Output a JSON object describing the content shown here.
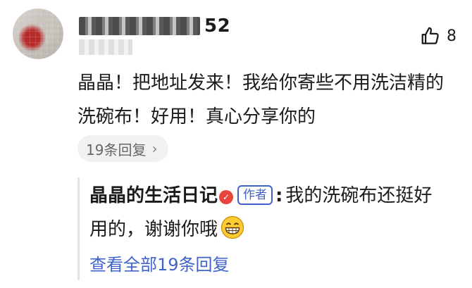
{
  "comment": {
    "username_suffix": "52",
    "likes": "8",
    "text": "晶晶！把地址发来！我给你寄些不用洗洁精的洗碗布！好用！真心分享你的",
    "reply_count_label": "19条回复"
  },
  "reply": {
    "author": "晶晶的生活日记",
    "author_tag": "作者",
    "separator": ":",
    "text": "我的洗碗布还挺好用的，谢谢你哦",
    "view_all_label": "查看全部19条回复"
  },
  "icons": {
    "like": "thumbs-up-icon",
    "verified": "verified-badge-icon",
    "emoji": "grinning-face-icon",
    "chevron": "chevron-right-icon"
  },
  "colors": {
    "accent": "#3f63c9",
    "verified": "#e8453c",
    "pill_bg": "#f1f1f1"
  }
}
